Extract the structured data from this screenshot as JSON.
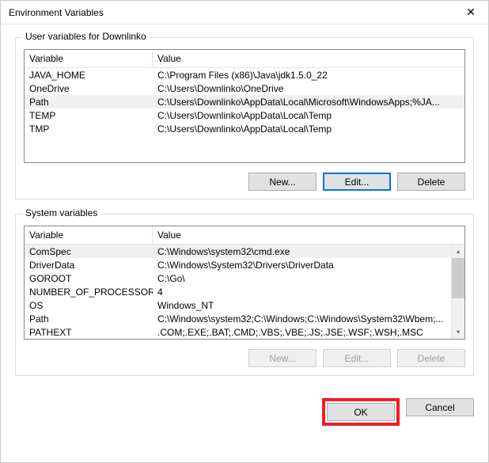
{
  "window": {
    "title": "Environment Variables",
    "close": "✕"
  },
  "user_group": {
    "label": "User variables for Downlinko",
    "col_variable": "Variable",
    "col_value": "Value",
    "rows": [
      {
        "name": "JAVA_HOME",
        "value": "C:\\Program Files (x86)\\Java\\jdk1.5.0_22"
      },
      {
        "name": "OneDrive",
        "value": "C:\\Users\\Downlinko\\OneDrive"
      },
      {
        "name": "Path",
        "value": "C:\\Users\\Downlinko\\AppData\\Local\\Microsoft\\WindowsApps;%JA..."
      },
      {
        "name": "TEMP",
        "value": "C:\\Users\\Downlinko\\AppData\\Local\\Temp"
      },
      {
        "name": "TMP",
        "value": "C:\\Users\\Downlinko\\AppData\\Local\\Temp"
      }
    ],
    "selected_index": 2,
    "buttons": {
      "new": "New...",
      "edit": "Edit...",
      "delete": "Delete"
    }
  },
  "system_group": {
    "label": "System variables",
    "col_variable": "Variable",
    "col_value": "Value",
    "rows": [
      {
        "name": "ComSpec",
        "value": "C:\\Windows\\system32\\cmd.exe"
      },
      {
        "name": "DriverData",
        "value": "C:\\Windows\\System32\\Drivers\\DriverData"
      },
      {
        "name": "GOROOT",
        "value": "C:\\Go\\"
      },
      {
        "name": "NUMBER_OF_PROCESSORS",
        "value": "4"
      },
      {
        "name": "OS",
        "value": "Windows_NT"
      },
      {
        "name": "Path",
        "value": "C:\\Windows\\system32;C:\\Windows;C:\\Windows\\System32\\Wbem;..."
      },
      {
        "name": "PATHEXT",
        "value": ".COM;.EXE;.BAT;.CMD;.VBS;.VBE;.JS;.JSE;.WSF;.WSH;.MSC"
      }
    ],
    "selected_index": 0,
    "buttons": {
      "new": "New...",
      "edit": "Edit...",
      "delete": "Delete"
    }
  },
  "footer": {
    "ok": "OK",
    "cancel": "Cancel"
  }
}
